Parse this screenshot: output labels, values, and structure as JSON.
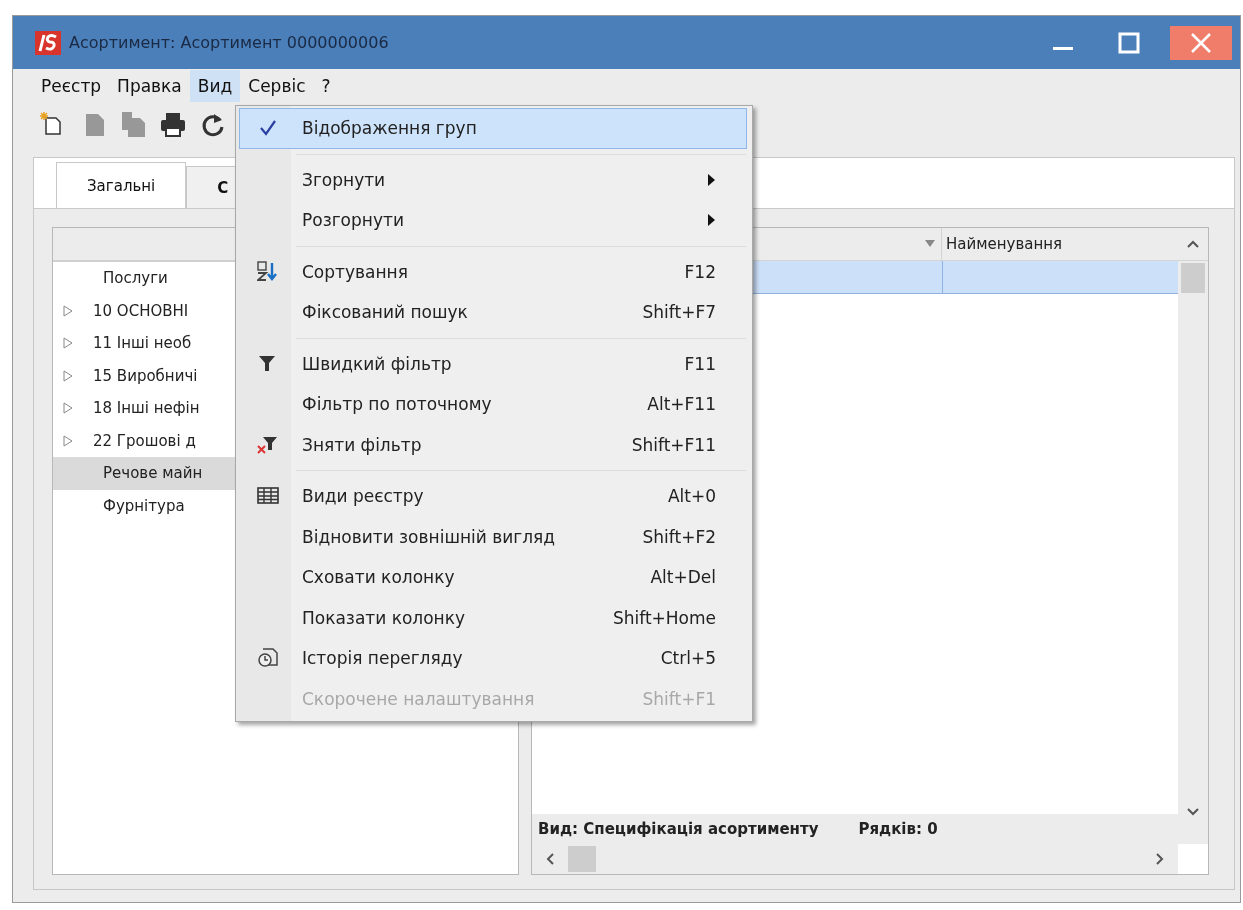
{
  "window": {
    "title": "Асортимент: Асортимент 0000000006"
  },
  "menu_bar": [
    {
      "label": "Реєстр",
      "selected": false
    },
    {
      "label": "Правка",
      "selected": false
    },
    {
      "label": "Вид",
      "selected": true
    },
    {
      "label": "Сервіс",
      "selected": false
    },
    {
      "label": "?",
      "selected": false
    }
  ],
  "toolbar": [
    {
      "disabled": false
    },
    {
      "disabled": true
    },
    {
      "disabled": true
    },
    {
      "disabled": false
    },
    {
      "disabled": false
    }
  ],
  "tabs": [
    {
      "label": "Загальні",
      "selected": false
    },
    {
      "label": "С",
      "selected": true
    }
  ],
  "tree": [
    {
      "label": "Послуги",
      "expandable": false,
      "selected": false
    },
    {
      "label": "10 ОСНОВНІ",
      "expandable": true,
      "selected": false
    },
    {
      "label": "11 Інші необ",
      "expandable": true,
      "selected": false
    },
    {
      "label": "15 Виробничі",
      "expandable": true,
      "selected": false
    },
    {
      "label": "18 Інші нефін",
      "expandable": true,
      "selected": false
    },
    {
      "label": "22 Грошові д",
      "expandable": true,
      "selected": false
    },
    {
      "label": "Речове майн",
      "expandable": false,
      "selected": true
    },
    {
      "label": "Фурнітура",
      "expandable": false,
      "selected": false
    }
  ],
  "table": {
    "columns": [
      {
        "filter": true
      },
      {
        "label": "Найменування",
        "filter": false
      }
    ],
    "rows": [
      {
        "selected": true
      }
    ],
    "footer": {
      "view": "Вид: Специфікація асортименту",
      "rows_count": "Рядків: 0"
    }
  },
  "view_menu": {
    "groups": [
      [
        {
          "label": "Відображення груп",
          "checked": true,
          "selected": true,
          "disabled": false
        }
      ],
      [
        {
          "label": "Згорнути",
          "submenu": true,
          "selected": false,
          "disabled": false
        },
        {
          "label": "Розгорнути",
          "submenu": true,
          "selected": false,
          "disabled": false
        }
      ],
      [
        {
          "label": "Сортування",
          "shortcut": "F12",
          "selected": false,
          "disabled": false
        },
        {
          "label": "Фіксований пошук",
          "shortcut": "Shift+F7",
          "selected": false,
          "disabled": false
        }
      ],
      [
        {
          "label": "Швидкий фільтр",
          "shortcut": "F11",
          "selected": false,
          "disabled": false
        },
        {
          "label": "Фільтр по поточному",
          "shortcut": "Alt+F11",
          "selected": false,
          "disabled": false
        },
        {
          "label": "Зняти фільтр",
          "shortcut": "Shift+F11",
          "selected": false,
          "disabled": false
        }
      ],
      [
        {
          "label": "Види реєстру",
          "shortcut": "Alt+0",
          "selected": false,
          "disabled": false
        },
        {
          "label": "Відновити зовнішній вигляд",
          "shortcut": "Shift+F2",
          "selected": false,
          "disabled": false
        },
        {
          "label": "Сховати колонку",
          "shortcut": "Alt+Del",
          "selected": false,
          "disabled": false
        },
        {
          "label": "Показати колонку",
          "shortcut": "Shift+Home",
          "selected": false,
          "disabled": false
        },
        {
          "label": "Історія перегляду",
          "shortcut": "Ctrl+5",
          "selected": false,
          "disabled": false
        },
        {
          "label": "Скорочене налаштування",
          "shortcut": "Shift+F1",
          "selected": false,
          "disabled": true
        }
      ]
    ]
  }
}
